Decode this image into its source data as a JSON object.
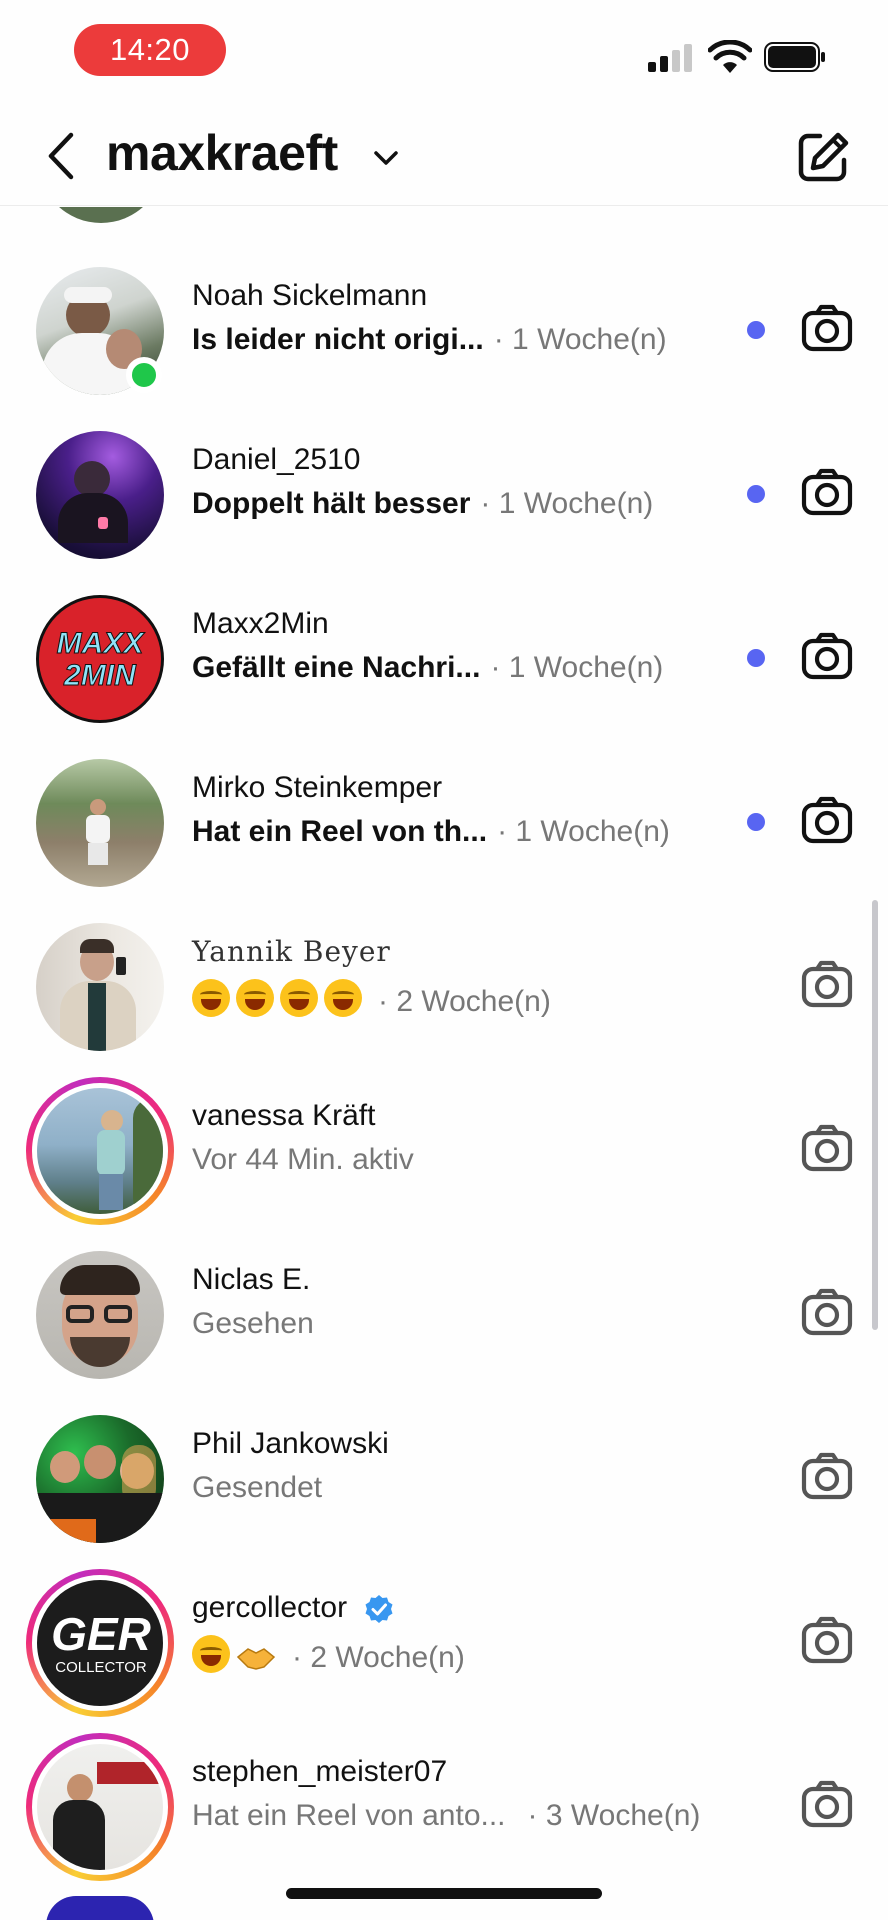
{
  "status_bar": {
    "time": "14:20",
    "wifi_icon": "wifi-icon",
    "battery_icon": "battery-icon",
    "signal_icon": "cellular-signal-icon"
  },
  "header": {
    "account_name": "maxkraeft",
    "back_icon": "chevron-left-icon",
    "dropdown_icon": "chevron-down-icon",
    "compose_icon": "compose-icon",
    "unread_dot_color": "#ee1c3c"
  },
  "colors": {
    "unread_blue": "#5865f2",
    "online_green": "#1fc74a",
    "status_pill": "#ec3b3b",
    "muted_text": "#777777"
  },
  "threads": [
    {
      "name": "Noah Sickelmann",
      "preview": "Is leider nicht origi...",
      "meta": "· 1 Woche(n)",
      "unread": true,
      "online": true,
      "story": false
    },
    {
      "name": "Daniel_2510",
      "preview": "Doppelt hält besser",
      "meta": "· 1 Woche(n)",
      "unread": true,
      "online": false,
      "story": false
    },
    {
      "name": "Maxx2Min",
      "preview": "Gefällt eine Nachri...",
      "meta": "· 1 Woche(n)",
      "unread": true,
      "online": false,
      "story": false,
      "avatar_text": "MAXX 2MIN"
    },
    {
      "name": "Mirko Steinkemper",
      "preview": "Hat ein Reel von th...",
      "meta": "· 1 Woche(n)",
      "unread": true,
      "online": false,
      "story": false
    },
    {
      "name": "Yannik Beyer",
      "preview": "😂😂😂😂",
      "meta": "· 2 Woche(n)",
      "unread": false,
      "online": false,
      "story": false
    },
    {
      "name": "vanessa Kräft",
      "preview": "Vor 44 Min. aktiv",
      "meta": "",
      "unread": false,
      "online": false,
      "story": true
    },
    {
      "name": "Niclas E.",
      "preview": "Gesehen",
      "meta": "",
      "unread": false,
      "online": false,
      "story": false
    },
    {
      "name": "Phil Jankowski",
      "preview": "Gesendet",
      "meta": "",
      "unread": false,
      "online": false,
      "story": false
    },
    {
      "name": "gercollector",
      "preview": "😅🤝",
      "meta": "· 2 Woche(n)",
      "unread": false,
      "online": false,
      "story": true,
      "verified": true,
      "avatar_text": "GER",
      "avatar_subtext": "COLLECTOR"
    },
    {
      "name": "stephen_meister07",
      "preview": "Hat ein Reel von anto...",
      "meta": "· 3 Woche(n)",
      "unread": false,
      "online": false,
      "story": true
    }
  ]
}
